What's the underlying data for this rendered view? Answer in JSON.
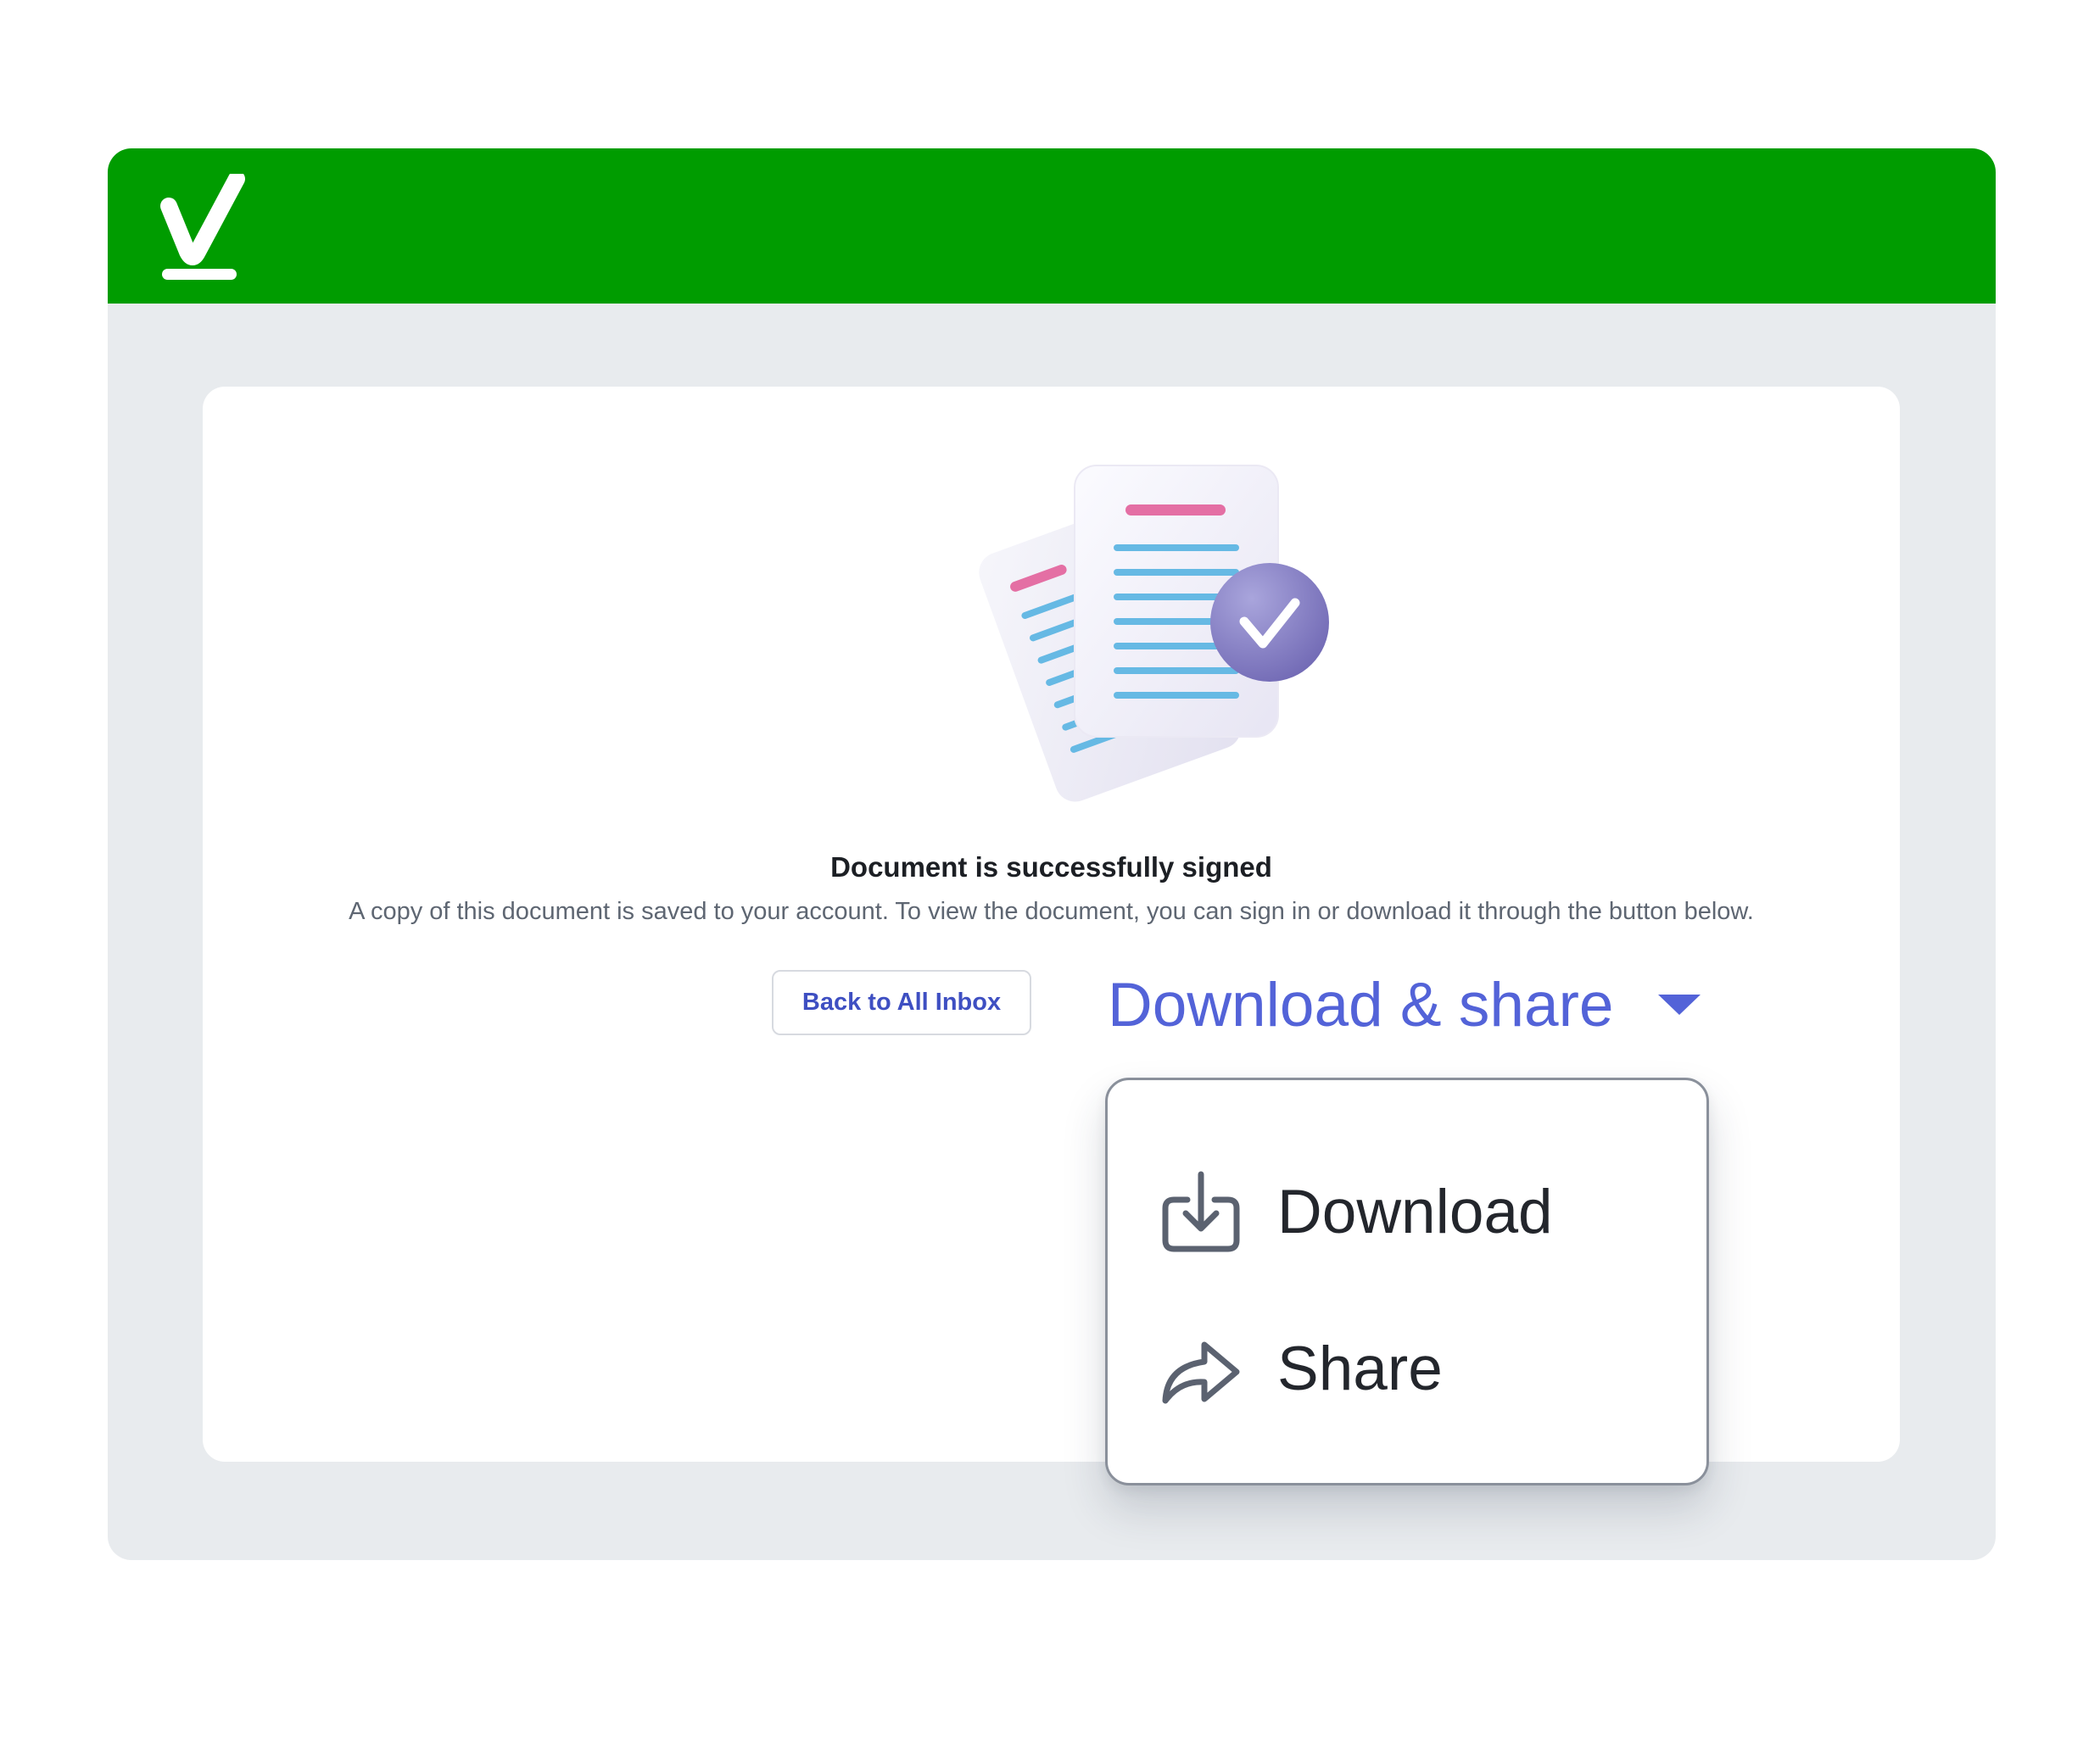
{
  "header": {
    "logo_icon": "checkmark-logo-icon",
    "background_color": "#009c00"
  },
  "main": {
    "illustration_icon": "signed-documents-illustration",
    "title": "Document is successfully signed",
    "description": "A copy of this document is saved to your account. To view the document, you can sign in or download it through the button below.",
    "back_button_label": "Back to All Inbox",
    "download_share_label": "Download & share",
    "accent_color": "#5363d8"
  },
  "dropdown": {
    "items": [
      {
        "label": "Download",
        "icon": "download-icon"
      },
      {
        "label": "Share",
        "icon": "share-arrow-icon"
      }
    ]
  }
}
